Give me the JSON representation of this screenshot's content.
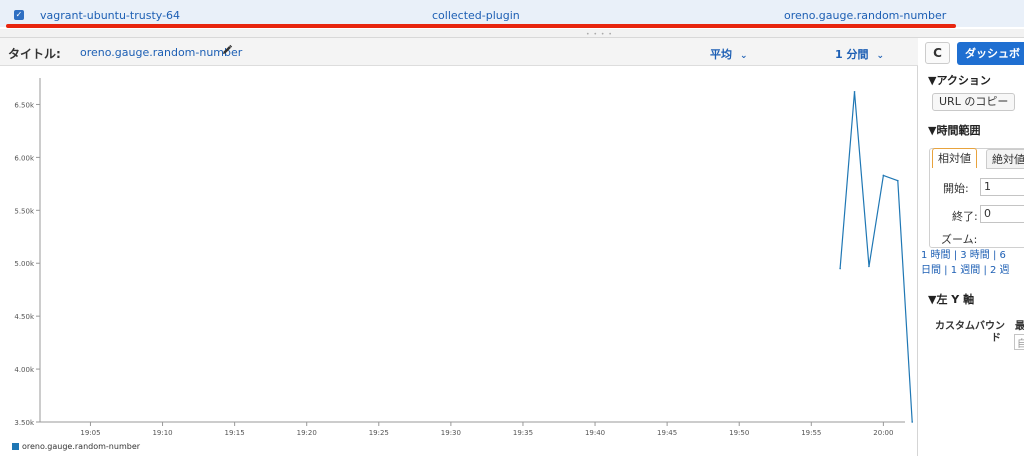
{
  "metric_row": {
    "checkbox_checked": true,
    "instance": "vagrant-ubuntu-trusty-64",
    "plugin": "collected-plugin",
    "metric": "oreno.gauge.random-number"
  },
  "chart_panel": {
    "title_label": "タイトル:",
    "title_value": "oreno.gauge.random-number",
    "statistic": "平均",
    "period": "1 分間",
    "legend": "oreno.gauge.random-number"
  },
  "sidebar": {
    "refresh_label": "C",
    "dashboard_button": "ダッシュボ",
    "actions_header": "▼アクション",
    "copy_url_button": "URL のコピー",
    "time_range_header": "▼時間範囲",
    "tab_relative": "相対値",
    "tab_absolute": "絶対値",
    "start_label": "開始:",
    "start_value": "1",
    "end_label": "終了:",
    "end_value": "0",
    "zoom_label": "ズーム:",
    "zoom_line1": "1 時間 | 3 時間 | 6",
    "zoom_line2": "日間 | 1 週間 | 2 週",
    "left_y_header": "▼左 Y 軸",
    "custom_bounds_line1": "カスタムバウン",
    "custom_bounds_line2": "ド",
    "custom_col_header": "最",
    "custom_input_placeholder": "自"
  },
  "colors": {
    "accent": "#1d5fb4",
    "series": "#1f77b4",
    "highlight_line": "#e8250f",
    "primary_button": "#1f6fd1"
  },
  "chart_data": {
    "type": "line",
    "title": "oreno.gauge.random-number",
    "xlabel": "",
    "ylabel": "",
    "ylim": [
      3.5,
      6.75
    ],
    "y_ticks": [
      "3.50k",
      "4.00k",
      "4.50k",
      "5.00k",
      "5.50k",
      "6.00k",
      "6.50k"
    ],
    "y_tick_values": [
      3.5,
      4.0,
      4.5,
      5.0,
      5.5,
      6.0,
      6.5
    ],
    "x_ticks": [
      "19:05",
      "19:10",
      "19:15",
      "19:20",
      "19:25",
      "19:30",
      "19:35",
      "19:40",
      "19:45",
      "19:50",
      "19:55",
      "20:00"
    ],
    "x_tick_minutes": [
      1145,
      1150,
      1155,
      1160,
      1165,
      1170,
      1175,
      1180,
      1185,
      1190,
      1195,
      1200
    ],
    "xlim_minutes": [
      1141.5,
      1201.5
    ],
    "series": [
      {
        "name": "oreno.gauge.random-number",
        "x_minutes": [
          1197,
          1198,
          1199,
          1200,
          1201,
          1202
        ],
        "x": [
          "19:57",
          "19:58",
          "19:59",
          "20:00",
          "20:01",
          "20:02"
        ],
        "values": [
          4.95,
          6.62,
          4.97,
          5.83,
          5.78,
          3.5
        ]
      }
    ],
    "grid": false,
    "legend_position": "bottom-left"
  }
}
